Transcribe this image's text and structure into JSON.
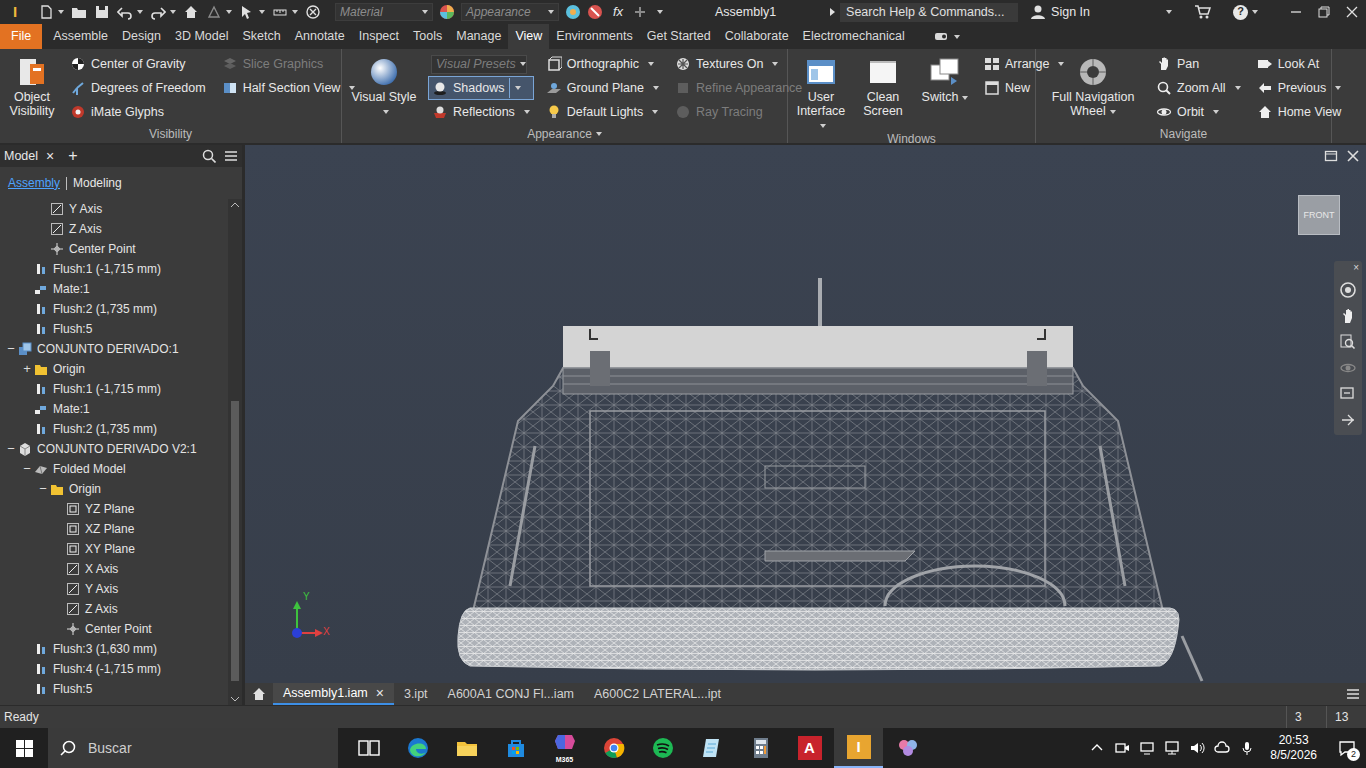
{
  "window": {
    "title": "Assembly1"
  },
  "title_bar": {
    "app_logo": "I",
    "material_placeholder": "Material",
    "appearance_placeholder": "Appearance",
    "fx": "fx",
    "search_placeholder": "Search Help & Commands...",
    "sign_in": "Sign In",
    "help": "?"
  },
  "ribbon": {
    "file_tab": "File",
    "tabs": [
      {
        "label": "Assemble",
        "selected": false
      },
      {
        "label": "Design",
        "selected": false
      },
      {
        "label": "3D Model",
        "selected": false
      },
      {
        "label": "Sketch",
        "selected": false
      },
      {
        "label": "Annotate",
        "selected": false
      },
      {
        "label": "Inspect",
        "selected": false
      },
      {
        "label": "Tools",
        "selected": false
      },
      {
        "label": "Manage",
        "selected": false
      },
      {
        "label": "View",
        "selected": true
      },
      {
        "label": "Environments",
        "selected": false
      },
      {
        "label": "Get Started",
        "selected": false
      },
      {
        "label": "Collaborate",
        "selected": false
      },
      {
        "label": "Electromechanical",
        "selected": false
      }
    ],
    "groups": [
      {
        "title": "Visibility",
        "dropdown": false,
        "columns": [
          [
            {
              "label": "Object Visibility",
              "kind": "large",
              "selected": false,
              "disabled": false,
              "dropdown": false
            }
          ],
          [
            {
              "label": "Center of Gravity",
              "kind": "small",
              "selected": false,
              "disabled": false,
              "dropdown": false
            },
            {
              "label": "Degrees of Freedom",
              "kind": "small",
              "selected": false,
              "disabled": false,
              "dropdown": false
            },
            {
              "label": "iMate Glyphs",
              "kind": "small",
              "selected": false,
              "disabled": false,
              "dropdown": false
            }
          ],
          [
            {
              "label": "Slice Graphics",
              "kind": "small",
              "selected": false,
              "disabled": true,
              "dropdown": false
            },
            {
              "label": "Half Section View",
              "kind": "small",
              "selected": false,
              "disabled": false,
              "dropdown": true
            }
          ]
        ]
      },
      {
        "title": "Appearance",
        "dropdown": true,
        "columns": [
          [
            {
              "label": "Visual Style",
              "kind": "large",
              "selected": false,
              "disabled": false,
              "dropdown": true
            }
          ],
          [
            {
              "label": "Visual Presets",
              "kind": "combo",
              "selected": false,
              "disabled": true,
              "dropdown": true
            },
            {
              "label": "Shadows",
              "kind": "small",
              "selected": true,
              "disabled": false,
              "dropdown": true
            },
            {
              "label": "Reflections",
              "kind": "small",
              "selected": false,
              "disabled": false,
              "dropdown": true
            }
          ],
          [
            {
              "label": "Orthographic",
              "kind": "small",
              "selected": false,
              "disabled": false,
              "dropdown": true
            },
            {
              "label": "Ground Plane",
              "kind": "small",
              "selected": false,
              "disabled": false,
              "dropdown": true
            },
            {
              "label": "Default Lights",
              "kind": "small",
              "selected": false,
              "disabled": false,
              "dropdown": true
            }
          ],
          [
            {
              "label": "Textures On",
              "kind": "small",
              "selected": false,
              "disabled": false,
              "dropdown": true
            },
            {
              "label": "Refine Appearance",
              "kind": "small",
              "selected": false,
              "disabled": true,
              "dropdown": false
            },
            {
              "label": "Ray Tracing",
              "kind": "small",
              "selected": false,
              "disabled": true,
              "dropdown": false
            }
          ]
        ]
      },
      {
        "title": "Windows",
        "dropdown": false,
        "columns": [
          [
            {
              "label": "User Interface",
              "kind": "large",
              "selected": false,
              "disabled": false,
              "dropdown": true
            }
          ],
          [
            {
              "label": "Clean Screen",
              "kind": "large",
              "selected": false,
              "disabled": false,
              "dropdown": false
            }
          ],
          [
            {
              "label": "Switch",
              "kind": "large",
              "selected": false,
              "disabled": false,
              "dropdown": true
            }
          ],
          [
            {
              "label": "Arrange",
              "kind": "small",
              "selected": false,
              "disabled": false,
              "dropdown": true
            },
            {
              "label": "New",
              "kind": "small",
              "selected": false,
              "disabled": false,
              "dropdown": false
            }
          ]
        ]
      },
      {
        "title": "Navigate",
        "dropdown": false,
        "columns": [
          [
            {
              "label": "Full Navigation Wheel",
              "kind": "large",
              "selected": false,
              "disabled": false,
              "dropdown": true
            }
          ],
          [
            {
              "label": "Pan",
              "kind": "small",
              "selected": false,
              "disabled": false,
              "dropdown": false
            },
            {
              "label": "Zoom All",
              "kind": "small",
              "selected": false,
              "disabled": false,
              "dropdown": true
            },
            {
              "label": "Orbit",
              "kind": "small",
              "selected": false,
              "disabled": false,
              "dropdown": true
            }
          ],
          [
            {
              "label": "Look At",
              "kind": "small",
              "selected": false,
              "disabled": false,
              "dropdown": false
            },
            {
              "label": "Previous",
              "kind": "small",
              "selected": false,
              "disabled": false,
              "dropdown": true
            },
            {
              "label": "Home View",
              "kind": "small",
              "selected": false,
              "disabled": false,
              "dropdown": false
            }
          ]
        ]
      }
    ]
  },
  "browser": {
    "tab": "Model",
    "close": "×",
    "add": "+",
    "modes": [
      {
        "label": "Assembly",
        "selected": true
      },
      {
        "label": "Modeling",
        "selected": false
      }
    ],
    "tree": [
      {
        "label": "Y Axis",
        "level": 2,
        "expander": "",
        "kind": "axis"
      },
      {
        "label": "Z Axis",
        "level": 2,
        "expander": "",
        "kind": "axis"
      },
      {
        "label": "Center Point",
        "level": 2,
        "expander": "",
        "kind": "point"
      },
      {
        "label": "Flush:1 (-1,715 mm)",
        "level": 1,
        "expander": "",
        "kind": "flush"
      },
      {
        "label": "Mate:1",
        "level": 1,
        "expander": "",
        "kind": "mate"
      },
      {
        "label": "Flush:2 (1,735 mm)",
        "level": 1,
        "expander": "",
        "kind": "flush"
      },
      {
        "label": "Flush:5",
        "level": 1,
        "expander": "",
        "kind": "flush"
      },
      {
        "label": "CONJUNTO DERIVADO:1",
        "level": 0,
        "expander": "−",
        "kind": "assembly"
      },
      {
        "label": "Origin",
        "level": 1,
        "expander": "+",
        "kind": "folder"
      },
      {
        "label": "Flush:1 (-1,715 mm)",
        "level": 1,
        "expander": "",
        "kind": "flush"
      },
      {
        "label": "Mate:1",
        "level": 1,
        "expander": "",
        "kind": "mate"
      },
      {
        "label": "Flush:2 (1,735 mm)",
        "level": 1,
        "expander": "",
        "kind": "flush"
      },
      {
        "label": "CONJUNTO DERIVADO V2:1",
        "level": 0,
        "expander": "−",
        "kind": "part"
      },
      {
        "label": "Folded Model",
        "level": 1,
        "expander": "−",
        "kind": "folded"
      },
      {
        "label": "Origin",
        "level": 2,
        "expander": "−",
        "kind": "folder"
      },
      {
        "label": "YZ Plane",
        "level": 3,
        "expander": "",
        "kind": "plane"
      },
      {
        "label": "XZ Plane",
        "level": 3,
        "expander": "",
        "kind": "plane"
      },
      {
        "label": "XY Plane",
        "level": 3,
        "expander": "",
        "kind": "plane"
      },
      {
        "label": "X Axis",
        "level": 3,
        "expander": "",
        "kind": "axis"
      },
      {
        "label": "Y Axis",
        "level": 3,
        "expander": "",
        "kind": "axis"
      },
      {
        "label": "Z Axis",
        "level": 3,
        "expander": "",
        "kind": "axis"
      },
      {
        "label": "Center Point",
        "level": 3,
        "expander": "",
        "kind": "point"
      },
      {
        "label": "Flush:3 (1,630 mm)",
        "level": 1,
        "expander": "",
        "kind": "flush"
      },
      {
        "label": "Flush:4 (-1,715 mm)",
        "level": 1,
        "expander": "",
        "kind": "flush"
      },
      {
        "label": "Flush:5",
        "level": 1,
        "expander": "",
        "kind": "flush"
      }
    ]
  },
  "viewport": {
    "view_cube": "FRONT",
    "axis_y": "Y",
    "axis_x": "X",
    "nav_close": "×"
  },
  "document_tabs": [
    {
      "label": "Assembly1.iam",
      "selected": true,
      "close": "×"
    },
    {
      "label": "3.ipt",
      "selected": false
    },
    {
      "label": "A600A1 CONJ Fl...iam",
      "selected": false
    },
    {
      "label": "A600C2 LATERAL...ipt",
      "selected": false
    }
  ],
  "status_bar": {
    "text": "Ready",
    "counts": [
      "3",
      "13"
    ]
  },
  "taskbar": {
    "search_placeholder": "Buscar",
    "apps": [
      {
        "kind": "taskview",
        "selected": false
      },
      {
        "kind": "edge",
        "selected": false
      },
      {
        "kind": "explorer",
        "selected": false
      },
      {
        "kind": "store",
        "selected": false
      },
      {
        "kind": "m365",
        "selected": false,
        "glyph": "M365"
      },
      {
        "kind": "chrome",
        "selected": false
      },
      {
        "kind": "spotify",
        "selected": false
      },
      {
        "kind": "notes",
        "selected": false
      },
      {
        "kind": "calculator",
        "selected": false
      },
      {
        "kind": "autocad",
        "selected": false,
        "glyph": "A"
      },
      {
        "kind": "inventor",
        "selected": true,
        "glyph": "I"
      },
      {
        "kind": "flower",
        "selected": false
      }
    ],
    "time": "20:53",
    "date": "8/5/2026",
    "notifications": "2"
  }
}
